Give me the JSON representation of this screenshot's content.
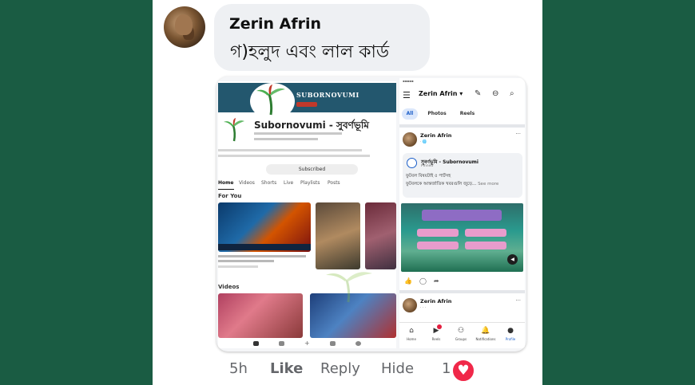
{
  "comment": {
    "author": "Zerin Afrin",
    "text": "গ)হলুদ এবং লাল কার্ড",
    "time": "5h",
    "like_label": "Like",
    "reply_label": "Reply",
    "hide_label": "Hide",
    "reaction_count": "1",
    "reaction_icon": "heart-icon"
  },
  "attachment": {
    "youtube": {
      "banner_title": "SUBORNOVUMI",
      "channel_title": "Subornovumi - সুবর্ণভূমি",
      "subscribe_label": "Subscribed",
      "tabs": [
        "Home",
        "Videos",
        "Shorts",
        "Live",
        "Playlists",
        "Posts"
      ],
      "for_you_label": "For You",
      "videos_label": "Videos"
    },
    "facebook": {
      "profile_name": "Zerin Afrin",
      "filters": [
        "All",
        "Photos",
        "Reels"
      ],
      "post_author": "Zerin Afrin",
      "shared_page": "সুবর্ণভূমি - Subornovumi",
      "shared_meta": "Pinned",
      "shared_line_1": "ফুটবল বিষয়টাই ৫ পার্টসহ",
      "shared_line_2": "ফুটবলকে আন্তর্জাতিক খবরগুলি জুড়ে...",
      "see_more": "See more",
      "story_name": "Zerin Afrin",
      "nav": [
        "Home",
        "Reels",
        "Groups",
        "Notifications",
        "Profile"
      ]
    }
  },
  "colors": {
    "background": "#1a5c43",
    "accent_blue": "#1b5ec9",
    "reaction_red": "#f02849"
  }
}
